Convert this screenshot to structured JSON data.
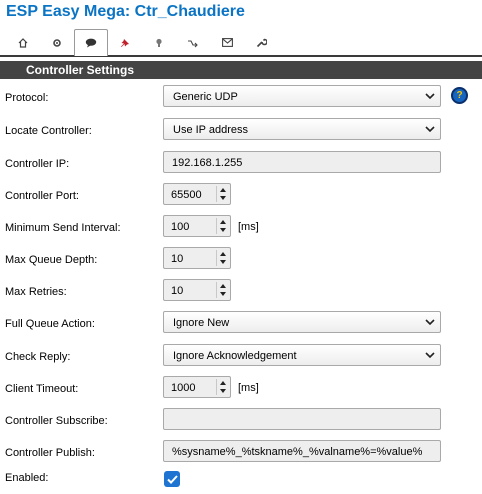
{
  "app_title": "ESP Easy Mega: Ctr_Chaudiere",
  "tabs": [
    {
      "icon": "home-icon"
    },
    {
      "icon": "gear-icon"
    },
    {
      "icon": "speech-bubble-icon"
    },
    {
      "icon": "pushpin-icon"
    },
    {
      "icon": "lightbulb-icon"
    },
    {
      "icon": "rules-arrow-icon"
    },
    {
      "icon": "envelope-icon"
    },
    {
      "icon": "wrench-icon"
    }
  ],
  "active_tab": 2,
  "section_title": "Controller Settings",
  "fields": {
    "protocol": {
      "label": "Protocol:",
      "value": "Generic UDP"
    },
    "locate": {
      "label": "Locate Controller:",
      "value": "Use IP address"
    },
    "ip": {
      "label": "Controller IP:",
      "value": "192.168.1.255"
    },
    "port": {
      "label": "Controller Port:",
      "value": "65500"
    },
    "min_send": {
      "label": "Minimum Send Interval:",
      "value": "100",
      "unit": "[ms]"
    },
    "queue_depth": {
      "label": "Max Queue Depth:",
      "value": "10"
    },
    "retries": {
      "label": "Max Retries:",
      "value": "10"
    },
    "full_queue": {
      "label": "Full Queue Action:",
      "value": "Ignore New"
    },
    "check_reply": {
      "label": "Check Reply:",
      "value": "Ignore Acknowledgement"
    },
    "timeout": {
      "label": "Client Timeout:",
      "value": "1000",
      "unit": "[ms]"
    },
    "subscribe": {
      "label": "Controller Subscribe:",
      "value": ""
    },
    "publish": {
      "label": "Controller Publish:",
      "value": "%sysname%_%tskname%_%valname%=%value%"
    },
    "enabled": {
      "label": "Enabled:",
      "checked": true
    }
  },
  "help_glyph": "?",
  "colors": {
    "title": "#0b74c4",
    "header_bg": "#444444",
    "checkbox": "#1e74d0",
    "help": "#1565c0"
  }
}
